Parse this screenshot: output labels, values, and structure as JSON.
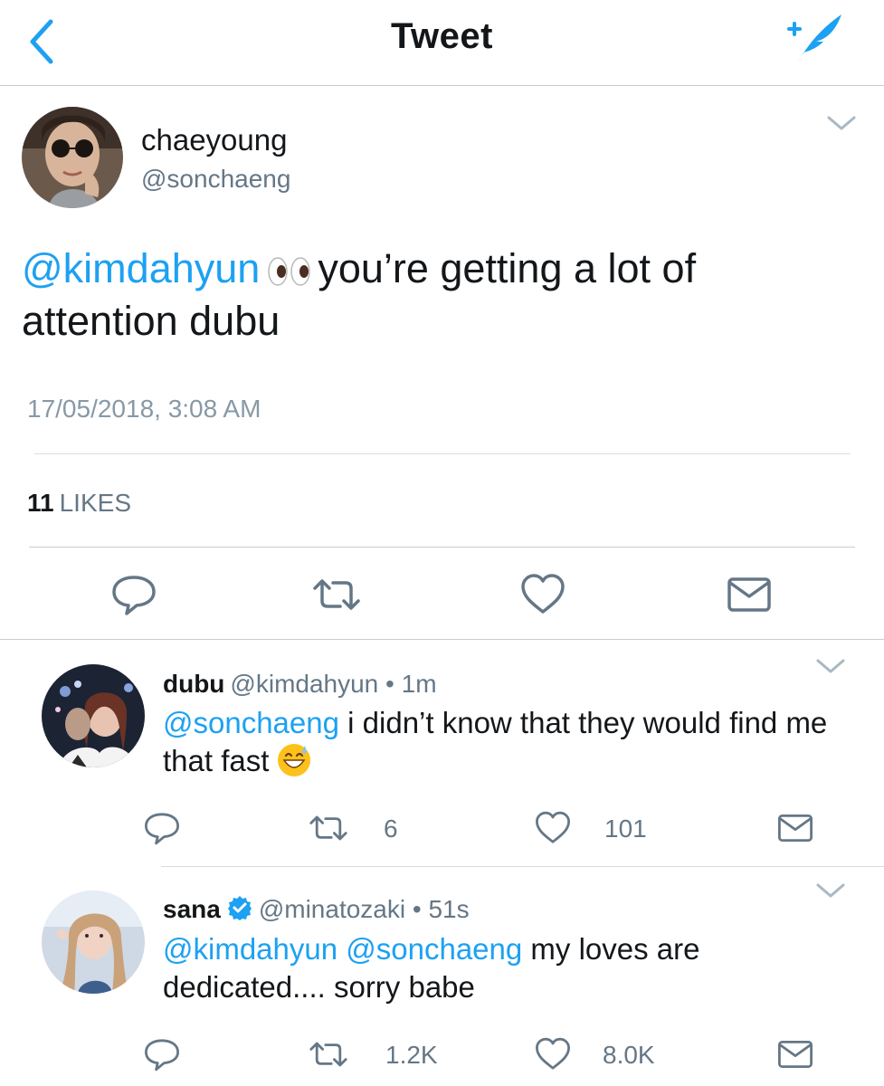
{
  "nav": {
    "title": "Tweet",
    "back_icon": "chevron-left-icon",
    "compose_icon": "compose-tweet-icon",
    "accent": "#1da1f2"
  },
  "tweet": {
    "name": "chaeyoung",
    "handle": "@sonchaeng",
    "mention": "@kimdahyun",
    "emoji": "eyes",
    "text": "you’re getting a lot of attention dubu",
    "timestamp": "17/05/2018, 3:08 AM",
    "likes_count": "11",
    "likes_label": "LIKES"
  },
  "replies": [
    {
      "name": "dubu",
      "handle": "@kimdahyun",
      "dot": "•",
      "time": "1m",
      "mention": "@sonchaeng",
      "text": "i didn’t know that they would find me that fast",
      "emoji": "grinning-sweat",
      "retweets": "6",
      "likes": "101"
    },
    {
      "name": "sana",
      "verified": true,
      "handle": "@minatozaki",
      "dot": "•",
      "time": "51s",
      "mention1": "@kimdahyun",
      "mention2": "@sonchaeng",
      "text": "my loves are dedicated.... sorry babe",
      "retweets": "1.2K",
      "likes": "8.0K"
    }
  ],
  "colors": {
    "link": "#1da1f2",
    "secondary": "#657786",
    "icon": "#657786",
    "text": "#14171a"
  }
}
